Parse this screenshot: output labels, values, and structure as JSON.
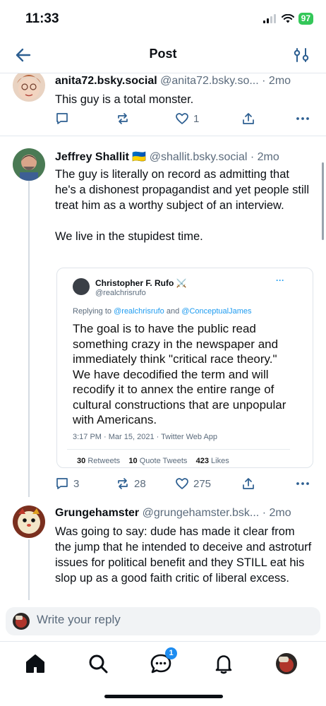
{
  "status": {
    "time": "11:33",
    "battery": "97"
  },
  "header": {
    "title": "Post"
  },
  "posts": [
    {
      "display_name": "anita72.bsky.social",
      "handle": "@anita72.bsky.so...",
      "time": "· 2mo",
      "text": "This guy is a total monster.",
      "replies": "",
      "reposts": "",
      "likes": "1"
    },
    {
      "display_name": "Jeffrey Shallit",
      "flag": "🇺🇦",
      "handle": "@shallit.bsky.social",
      "time": "· 2mo",
      "text": "The guy is literally on record as admitting that he's a dishonest propagandist and yet people still treat him as a worthy subject of an interview.\n\nWe live in the stupidest time.",
      "replies": "3",
      "reposts": "28",
      "likes": "275",
      "quote": {
        "name": "Christopher F. Rufo",
        "name_icon": "⚔️",
        "handle": "@realchrisrufo",
        "more": "···",
        "replying_prefix": "Replying to",
        "replying_to_1": "@realchrisrufo",
        "replying_and": "and",
        "replying_to_2": "@ConceptualJames",
        "body": "The goal is to have the public read something crazy in the newspaper and immediately think \"critical race theory.\" We have decodified the term and will recodify it to annex the entire range of cultural constructions that are unpopular with Americans.",
        "meta": "3:17 PM · Mar 15, 2021 · Twitter Web App",
        "retweets_count": "30",
        "retweets_label": "Retweets",
        "quote_tweets_count": "10",
        "quote_tweets_label": "Quote Tweets",
        "likes_count": "423",
        "likes_label": "Likes"
      }
    },
    {
      "display_name": "Grungehamster",
      "handle": "@grungehamster.bsk...",
      "time": "· 2mo",
      "text": "Was going to say: dude has made it clear from the jump that he intended to deceive and astroturf issues for political benefit and they STILL eat his slop up as a good faith critic of liberal excess."
    }
  ],
  "reply": {
    "placeholder": "Write your reply"
  },
  "tabs": {
    "chat_badge": "1"
  },
  "colors": {
    "accent": "#1d8cf0",
    "text": "#0b0f14",
    "muted": "#5b6b7c",
    "divider": "#e3e8ee",
    "battery": "#34c759"
  }
}
